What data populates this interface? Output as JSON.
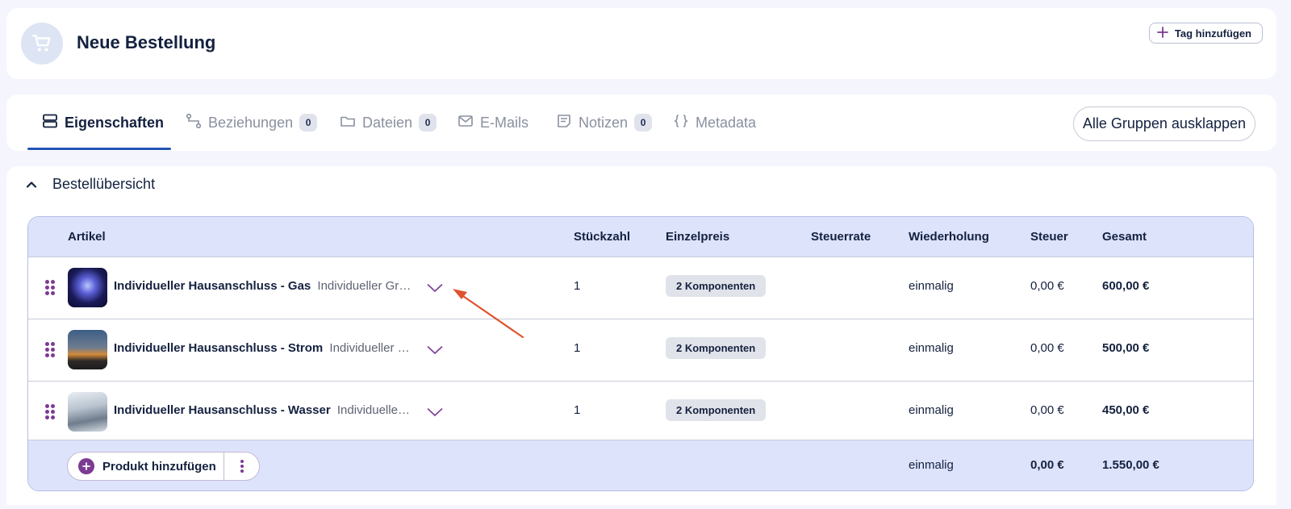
{
  "header": {
    "title": "Neue Bestellung",
    "avatar_icon": "shopping-cart-icon",
    "tag_button_label": "Tag hinzufügen"
  },
  "tabs": [
    {
      "label": "Eigenschaften",
      "icon": "list-icon",
      "active": true
    },
    {
      "label": "Beziehungen",
      "icon": "relations-icon",
      "count": "0"
    },
    {
      "label": "Dateien",
      "icon": "folder-icon",
      "count": "0"
    },
    {
      "label": "E-Mails",
      "icon": "mail-icon"
    },
    {
      "label": "Notizen",
      "icon": "note-icon",
      "count": "0"
    },
    {
      "label": "Metadata",
      "icon": "braces-icon"
    }
  ],
  "expand_all_label": "Alle Gruppen ausklappen",
  "section": {
    "title": "Bestellübersicht",
    "columns": {
      "artikel": "Artikel",
      "stueckzahl": "Stückzahl",
      "einzelpreis": "Einzelpreis",
      "steuerrate": "Steuerrate",
      "wiederholung": "Wiederholung",
      "steuer": "Steuer",
      "gesamt": "Gesamt"
    },
    "rows": [
      {
        "name": "Individueller Hausanschluss - Gas",
        "description": "Individueller Grun...",
        "quantity": "1",
        "price_badge": "2 Komponenten",
        "recurrence": "einmalig",
        "tax": "0,00 €",
        "total": "600,00 €"
      },
      {
        "name": "Individueller Hausanschluss - Strom",
        "description": "Individueller Gr...",
        "quantity": "1",
        "price_badge": "2 Komponenten",
        "recurrence": "einmalig",
        "tax": "0,00 €",
        "total": "500,00 €"
      },
      {
        "name": "Individueller Hausanschluss - Wasser",
        "description": "Individueller ...",
        "quantity": "1",
        "price_badge": "2 Komponenten",
        "recurrence": "einmalig",
        "tax": "0,00 €",
        "total": "450,00 €"
      }
    ],
    "footer": {
      "add_product_label": "Produkt hinzufügen",
      "recurrence": "einmalig",
      "tax": "0,00 €",
      "total": "1.550,00 €"
    }
  },
  "colors": {
    "accent": "#2554b6",
    "purple": "#7b3b93",
    "table_header_bg": "#dde3fb",
    "annotation_arrow": "#e0532f"
  }
}
